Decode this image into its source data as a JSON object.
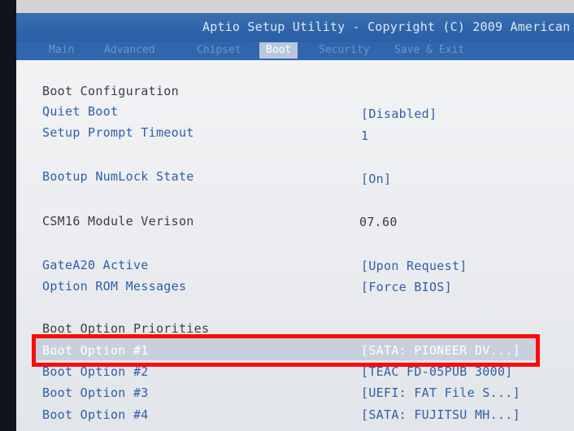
{
  "header": {
    "title": "Aptio Setup Utility - Copyright (C) 2009 American",
    "tabs": [
      {
        "label": "Main"
      },
      {
        "label": "Advanced"
      },
      {
        "label": "Chipset"
      },
      {
        "label": "Boot"
      },
      {
        "label": "Security"
      },
      {
        "label": "Save & Exit"
      }
    ]
  },
  "settings": {
    "section_title": "Boot Configuration",
    "quiet_boot": {
      "label": "Quiet Boot",
      "value": "[Disabled]"
    },
    "setup_prompt_timeout": {
      "label": "Setup Prompt Timeout",
      "value": "1"
    },
    "bootup_numlock": {
      "label": "Bootup NumLock State",
      "value": "[On]"
    },
    "csm16": {
      "label": "CSM16 Module Verison",
      "value": "07.60"
    },
    "gatea20": {
      "label": "GateA20 Active",
      "value": "[Upon Request]"
    },
    "option_rom": {
      "label": "Option ROM Messages",
      "value": "[Force BIOS]"
    },
    "priorities_title": "Boot Option Priorities",
    "boot_options": [
      {
        "label": "Boot Option #1",
        "value": "[SATA: PIONEER DV...]"
      },
      {
        "label": "Boot Option #2",
        "value": "[TEAC FD-05PUB 3000]"
      },
      {
        "label": "Boot Option #3",
        "value": "[UEFI: FAT File S...]"
      },
      {
        "label": "Boot Option #4",
        "value": "[SATA: FUJITSU MH...]"
      }
    ]
  },
  "colors": {
    "header_blue": "#2b62a8",
    "link_blue": "#2f5fa8",
    "highlight_red": "#ff0a0a"
  }
}
